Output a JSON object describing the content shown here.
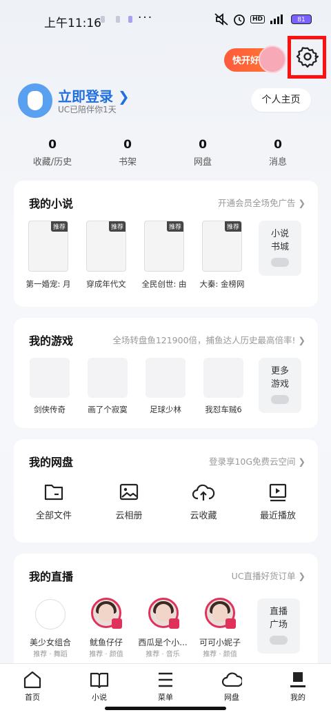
{
  "status": {
    "time": "上午11:16",
    "dots": "···",
    "hd": "HD",
    "battery": "81"
  },
  "promo": {
    "label": "快开好"
  },
  "profile": {
    "login": "立即登录 ❯",
    "sub": "UC已陪伴你1天",
    "home_btn": "个人主页"
  },
  "stats": [
    {
      "num": "0",
      "label": "收藏/历史"
    },
    {
      "num": "0",
      "label": "书架"
    },
    {
      "num": "0",
      "label": "网盘"
    },
    {
      "num": "0",
      "label": "消息"
    }
  ],
  "novel": {
    "title": "我的小说",
    "link": "开通会员全场免广告 ❯",
    "tag": "推荐",
    "books": [
      "第一婚宠: 月",
      "穿成年代文",
      "全民创世: 由",
      "大秦: 金榜网"
    ],
    "more": [
      "小说",
      "书城"
    ]
  },
  "games": {
    "title": "我的游戏",
    "link": "全场转盘鱼121900倍，捕鱼达人历史最高倍率! ❯",
    "items": [
      "剑侠传奇",
      "画了个寂寞",
      "足球少林",
      "我怼车贼6"
    ],
    "more": [
      "更多",
      "游戏"
    ]
  },
  "netdisk": {
    "title": "我的网盘",
    "link": "登录享10G免费云空间 ❯",
    "items": [
      "全部文件",
      "云相册",
      "云收藏",
      "最近播放"
    ]
  },
  "live": {
    "title": "我的直播",
    "link": "UC直播好货订单 ❯",
    "items": [
      {
        "name": "美少女组合",
        "sub": "推荐 · 舞蹈"
      },
      {
        "name": "鱿鱼仔仔",
        "sub": "推荐 · 颜值"
      },
      {
        "name": "西瓜是个小...",
        "sub": "推荐 · 音乐"
      },
      {
        "name": "可可小妮子",
        "sub": "推荐 · 颜值"
      }
    ],
    "more": [
      "直播",
      "广场"
    ]
  },
  "tabs": [
    "首页",
    "小说",
    "菜单",
    "网盘",
    "我的"
  ]
}
